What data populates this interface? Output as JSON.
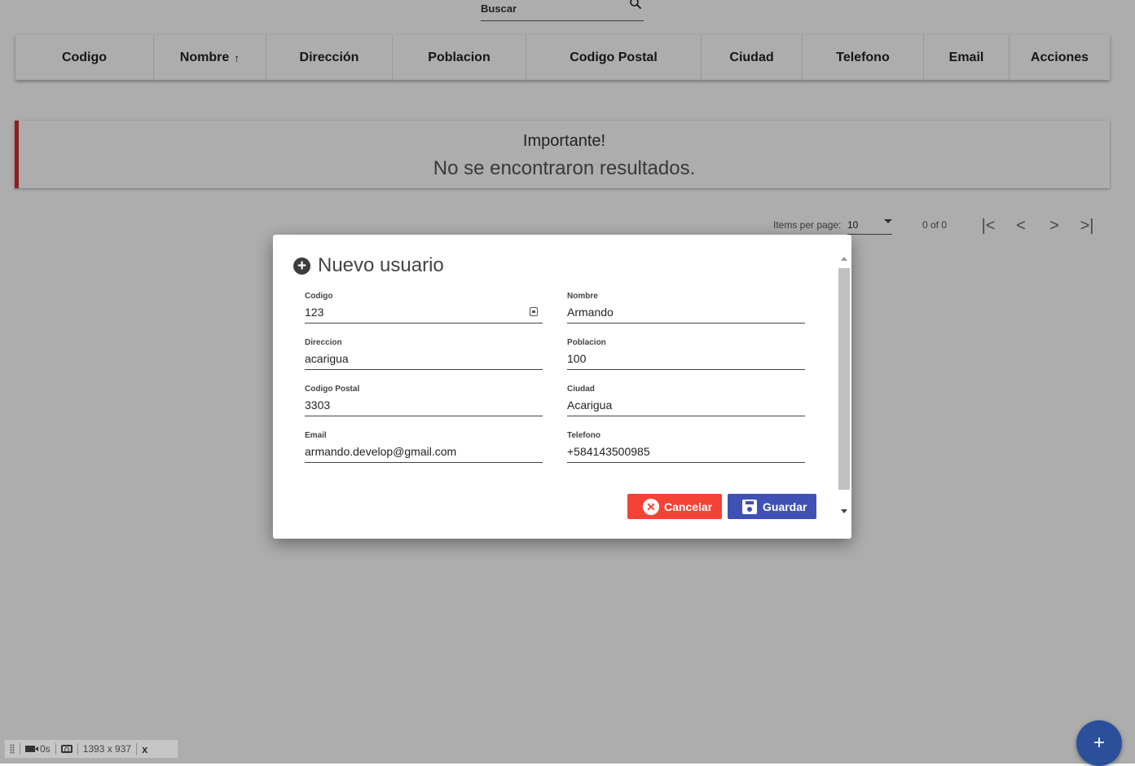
{
  "search": {
    "label": "Buscar",
    "icon": "search-icon"
  },
  "table": {
    "columns": [
      {
        "label": "Codigo"
      },
      {
        "label": "Nombre",
        "sorted": "ascending",
        "sort_glyph": "↑"
      },
      {
        "label": "Dirección"
      },
      {
        "label": "Poblacion"
      },
      {
        "label": "Codigo Postal"
      },
      {
        "label": "Ciudad"
      },
      {
        "label": "Telefono"
      },
      {
        "label": "Email"
      },
      {
        "label": "Acciones"
      }
    ]
  },
  "alert": {
    "title": "Importante!",
    "message": "No se encontraron resultados.",
    "accent_color": "#d32f2f"
  },
  "paginator": {
    "items_per_page_label": "Items per page:",
    "items_per_page_value": "10",
    "range_label": "0 of 0",
    "buttons": {
      "first": "|<",
      "prev": "<",
      "next": ">",
      "last": ">|"
    }
  },
  "dialog": {
    "title": "Nuevo usuario",
    "fields": {
      "codigo": {
        "label": "Codigo",
        "value": "123"
      },
      "nombre": {
        "label": "Nombre",
        "value": "Armando"
      },
      "direccion": {
        "label": "Direccion",
        "value": "acarigua"
      },
      "poblacion": {
        "label": "Poblacion",
        "value": "100"
      },
      "codigo_postal": {
        "label": "Codigo Postal",
        "value": "3303"
      },
      "ciudad": {
        "label": "Ciudad",
        "value": "Acarigua"
      },
      "email": {
        "label": "Email",
        "value": "armando.develop@gmail.com"
      },
      "telefono": {
        "label": "Telefono",
        "value": "+584143500985"
      }
    },
    "buttons": {
      "cancel": {
        "label": "Cancelar",
        "color": "#f44336"
      },
      "save": {
        "label": "Guardar",
        "color": "#3f51b5"
      }
    }
  },
  "fab": {
    "label": "+",
    "color": "#2c4f9c"
  },
  "recorder": {
    "duration": "0s",
    "dimensions": "1393 x 937",
    "close": "x"
  }
}
